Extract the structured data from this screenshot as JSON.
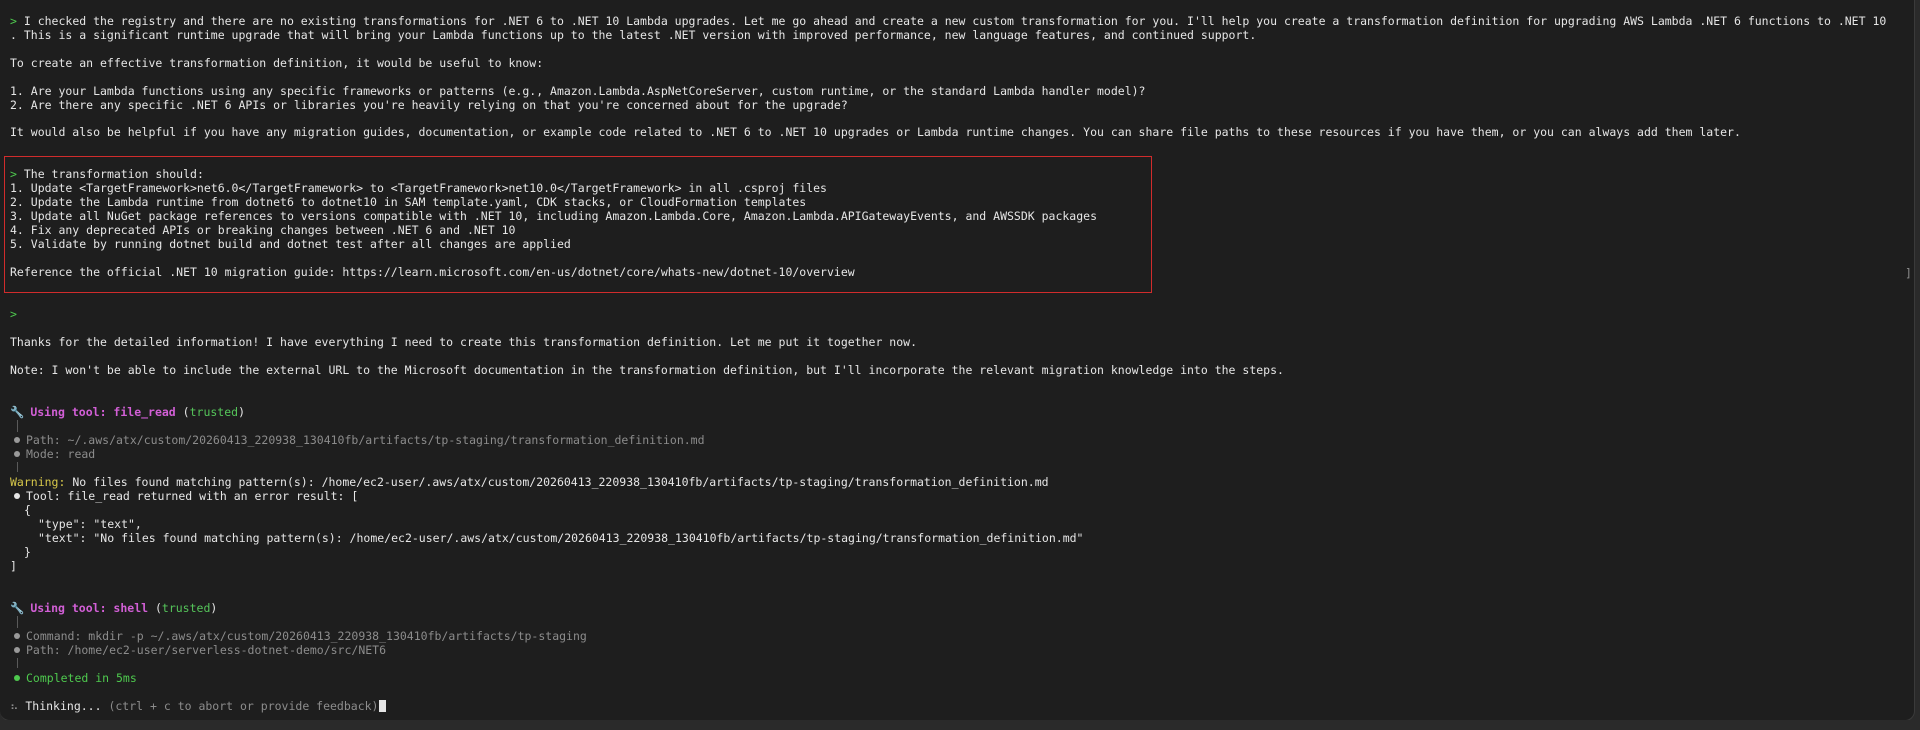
{
  "conversation": {
    "prompt_symbol": ">",
    "intro_line_1": " I checked the registry and there are no existing transformations for .NET 6 to .NET 10 Lambda upgrades. Let me go ahead and create a new custom transformation for you. I'll help you create a transformation definition for upgrading AWS Lambda .NET 6 functions to .NET 10",
    "intro_line_2": ". This is a significant runtime upgrade that will bring your Lambda functions up to the latest .NET version with improved performance, new language features, and continued support.",
    "ask_line": "To create an effective transformation definition, it would be useful to know:",
    "question_1": "1. Are your Lambda functions using any specific frameworks or patterns (e.g., Amazon.Lambda.AspNetCoreServer, custom runtime, or the standard Lambda handler model)?",
    "question_2": "2. Are there any specific .NET 6 APIs or libraries you're heavily relying on that you're concerned about for the upgrade?",
    "helpful_line": "It would also be helpful if you have any migration guides, documentation, or example code related to .NET 6 to .NET 10 upgrades or Lambda runtime changes. You can share file paths to these resources if you have them, or you can always add them later.",
    "user_header": " The transformation should:",
    "user_step_1": "1. Update <TargetFramework>net6.0</TargetFramework> to <TargetFramework>net10.0</TargetFramework> in all .csproj files",
    "user_step_2": "2. Update the Lambda runtime from dotnet6 to dotnet10 in SAM template.yaml, CDK stacks, or CloudFormation templates",
    "user_step_3": "3. Update all NuGet package references to versions compatible with .NET 10, including Amazon.Lambda.Core, Amazon.Lambda.APIGatewayEvents, and AWSSDK packages",
    "user_step_4": "4. Fix any deprecated APIs or breaking changes between .NET 6 and .NET 10",
    "user_step_5": "5. Validate by running dotnet build and dotnet test after all changes are applied",
    "user_reference": "Reference the official .NET 10 migration guide: https://learn.microsoft.com/en-us/dotnet/core/whats-new/dotnet-10/overview",
    "side_marker": "]",
    "thanks_line": "Thanks for the detailed information! I have everything I need to create this transformation definition. Let me put it together now.",
    "note_line": "Note: I won't be able to include the external URL to the Microsoft documentation in the transformation definition, but I'll incorporate the relevant migration knowledge into the steps."
  },
  "tool_read": {
    "prefix": "Using tool: ",
    "name": "file_read",
    "trust": "trusted",
    "path": "Path: ~/.aws/atx/custom/20260413_220938_130410fb/artifacts/tp-staging/transformation_definition.md",
    "mode": "Mode: read",
    "warning_label": "Warning:",
    "warning_text": " No files found matching pattern(s): /home/ec2-user/.aws/atx/custom/20260413_220938_130410fb/artifacts/tp-staging/transformation_definition.md",
    "error_line": "Tool: file_read returned with an error result: [",
    "json_open": "{",
    "json_type": "\"type\": \"text\",",
    "json_text": "\"text\": \"No files found matching pattern(s): /home/ec2-user/.aws/atx/custom/20260413_220938_130410fb/artifacts/tp-staging/transformation_definition.md\"",
    "json_close": "}",
    "bracket_close": "]"
  },
  "tool_shell": {
    "prefix": "Using tool: ",
    "name": "shell",
    "trust": "trusted",
    "command": "Command: mkdir -p ~/.aws/atx/custom/20260413_220938_130410fb/artifacts/tp-staging",
    "path": "Path: /home/ec2-user/serverless-dotnet-demo/src/NET6",
    "completed": "Completed in 5ms"
  },
  "status": {
    "thinking": "Thinking...",
    "hint": " (ctrl + c to abort or provide feedback)"
  },
  "colors": {
    "prompt": "#4ec94e",
    "tool": "#d25fd6",
    "trusted": "#55c55a",
    "warning": "#d7c84a",
    "highlight_border": "#d12c2c"
  }
}
